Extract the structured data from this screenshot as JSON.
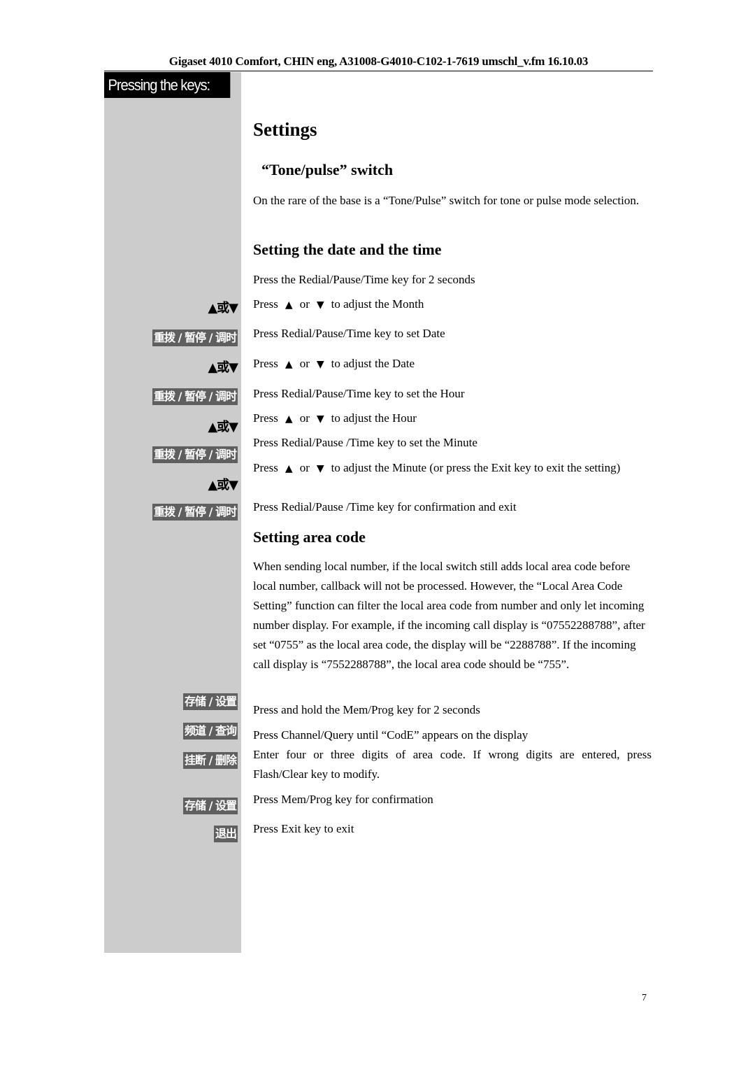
{
  "running_header": "Gigaset 4010 Comfort, CHIN eng, A31008-G4010-C102-1-7619 umschl_v.fm 16.10.03",
  "sidebar": {
    "title": "Pressing the keys:",
    "keys": {
      "updown": "▲或▼",
      "redial": "重拨 / 暂停 / 调时",
      "memprog": "存储 / 设置",
      "channel": "频道 / 查询",
      "flash": "挂断 / 删除",
      "exit": "退出"
    }
  },
  "content": {
    "title": "Settings",
    "tone": {
      "heading": "“Tone/pulse” switch",
      "body": "On the rare of the base is a “Tone/Pulse” switch for tone or pulse mode selection."
    },
    "datetime": {
      "heading": "Setting the date and the time",
      "steps": [
        "Press the Redial/Pause/Time key for 2 seconds",
        {
          "pre": "Press",
          "up": "▲",
          "or": "or",
          "down": "▼",
          "post": "to adjust the Month"
        },
        "Press Redial/Pause/Time key to set Date",
        {
          "pre": "Press",
          "up": "▲",
          "or": "or",
          "down": "▼",
          "post": "to adjust the Date"
        },
        "Press Redial/Pause/Time key to set the Hour",
        {
          "pre": "Press",
          "up": "▲",
          "or": "or",
          "down": "▼",
          "post": "to adjust the Hour"
        },
        "Press Redial/Pause /Time key to set the Minute",
        {
          "pre": "Press",
          "up": "▲",
          "or": "or",
          "down": "▼",
          "post": "to adjust the Minute (or press the Exit key to exit the setting)"
        },
        "Press Redial/Pause /Time key for confirmation and exit"
      ]
    },
    "areacode": {
      "heading": "Setting area code",
      "intro": "When sending local number, if the local switch still adds local area code before local number, callback will not be processed. However, the “Local Area Code Setting” function can filter the local area code from number and only let incoming number display. For example, if the incoming call display is “07552288788”, after set “0755” as the local area code, the display will be “2288788”. If the incoming call display is “7552288788”, the local area code should be “755”.",
      "steps": [
        "Press and hold the Mem/Prog key for 2 seconds",
        "Press Channel/Query until “CodE” appears on the display",
        "Enter four or three digits of area code. If wrong digits are entered, press Flash/Clear key to modify.",
        "Press Mem/Prog key for confirmation",
        "Press Exit key to exit"
      ]
    }
  },
  "page_number": "7"
}
